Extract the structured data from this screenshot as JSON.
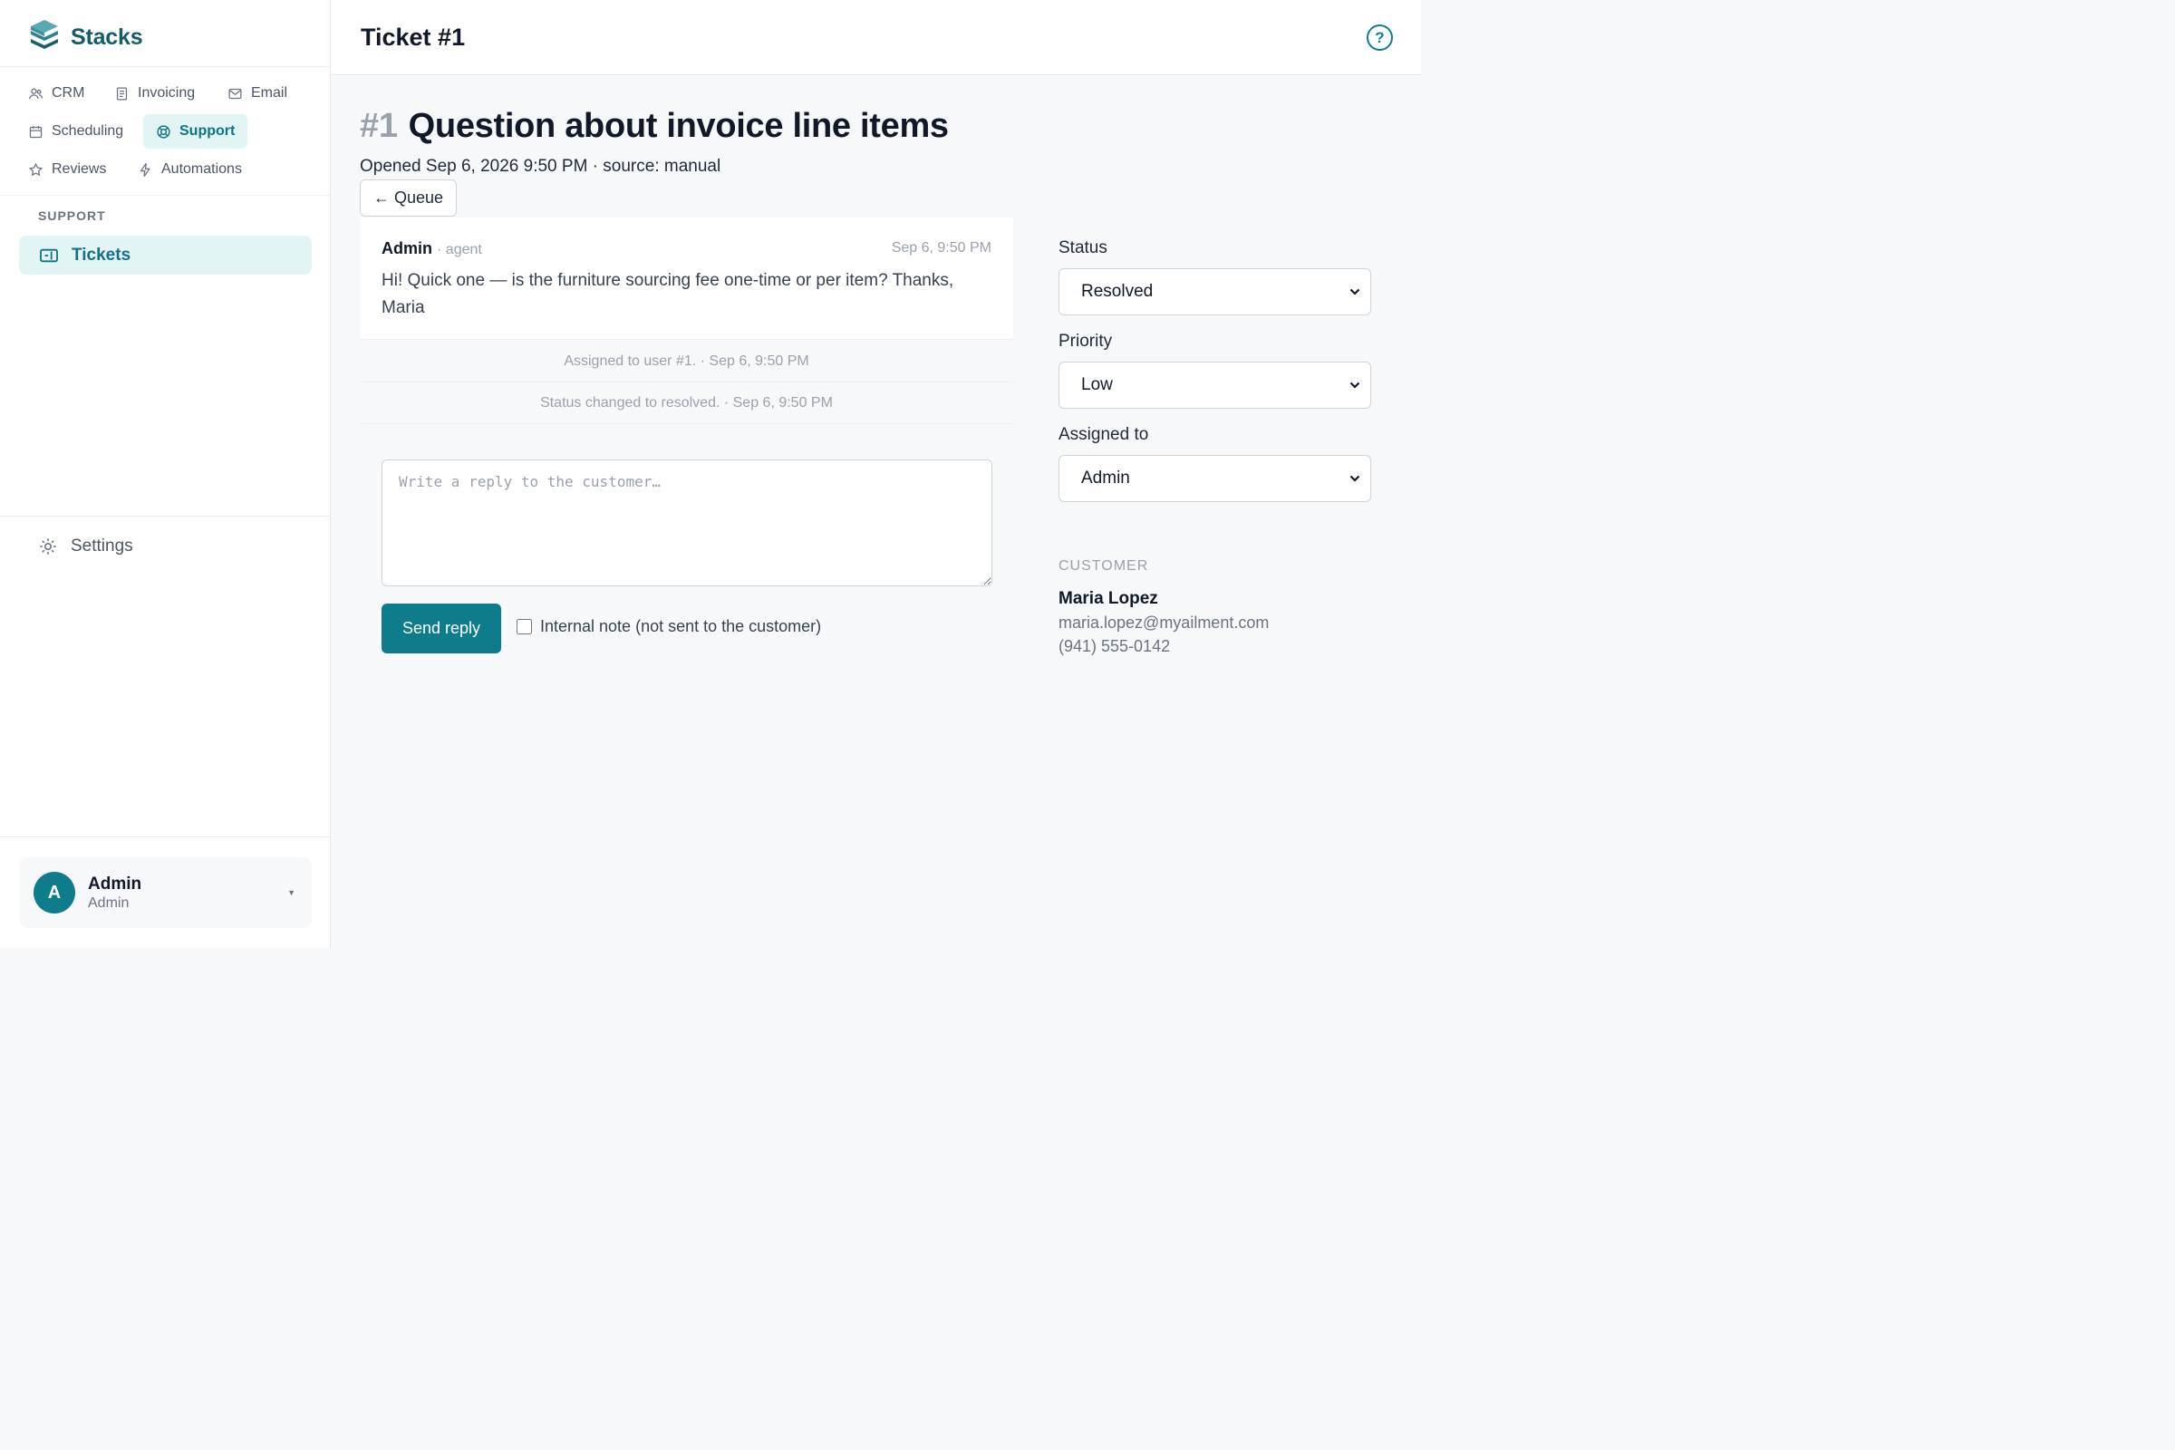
{
  "app": {
    "name": "Stacks",
    "brand_color": "#135d6b",
    "accent_color": "#0f7c8c"
  },
  "nav": {
    "items": [
      {
        "label": "CRM",
        "icon": "users-icon"
      },
      {
        "label": "Invoicing",
        "icon": "document-icon"
      },
      {
        "label": "Email",
        "icon": "mail-icon"
      },
      {
        "label": "Scheduling",
        "icon": "calendar-icon"
      },
      {
        "label": "Support",
        "icon": "lifebuoy-icon",
        "active": true
      },
      {
        "label": "Reviews",
        "icon": "star-icon"
      },
      {
        "label": "Automations",
        "icon": "bolt-icon"
      }
    ]
  },
  "sidebar": {
    "section_label": "SUPPORT",
    "tickets_label": "Tickets",
    "settings_label": "Settings"
  },
  "user": {
    "initial": "A",
    "name": "Admin",
    "role": "Admin"
  },
  "topbar": {
    "title": "Ticket #1",
    "help": "?"
  },
  "ticket": {
    "number": "#1",
    "subject": "Question about invoice line items",
    "meta": "Opened Sep 6, 2026 9:50 PM · source: manual",
    "back_label": "← Queue"
  },
  "message": {
    "author": "Admin",
    "role": "· agent",
    "time": "Sep 6, 9:50 PM",
    "body": "Hi! Quick one — is the furniture sourcing fee one-time or per item? Thanks, Maria"
  },
  "events": [
    "Assigned to user #1. · Sep 6, 9:50 PM",
    "Status changed to resolved. · Sep 6, 9:50 PM"
  ],
  "reply": {
    "placeholder": "Write a reply to the customer…",
    "send_label": "Send reply",
    "internal_note_label": "Internal note (not sent to the customer)",
    "internal_note_checked": false
  },
  "fields": {
    "status": {
      "label": "Status",
      "value": "Resolved"
    },
    "priority": {
      "label": "Priority",
      "value": "Low"
    },
    "assigned": {
      "label": "Assigned to",
      "value": "Admin"
    }
  },
  "customer": {
    "label": "CUSTOMER",
    "name": "Maria Lopez",
    "email": "maria.lopez@myailment.com",
    "phone": "(941) 555-0142"
  }
}
